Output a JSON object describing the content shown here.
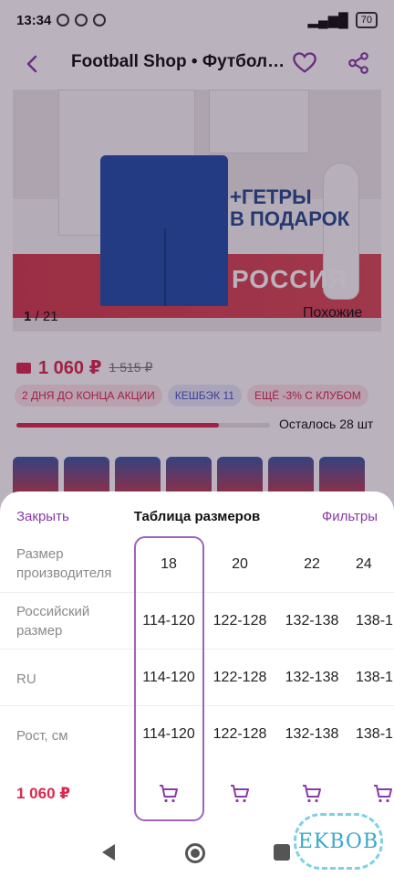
{
  "status_bar": {
    "time": "13:34",
    "battery": "70"
  },
  "topbar": {
    "title": "Football Shop • Футбольная форма"
  },
  "hero": {
    "promo_line1": "+ГЕТРЫ",
    "promo_line2": "В ПОДАРОК",
    "promo_country": "РОССИЯ",
    "counter_current": "1",
    "counter_total": "/ 21",
    "similar": "Похожие"
  },
  "price": {
    "current": "1 060 ₽",
    "old": "1 515 ₽"
  },
  "badges": [
    "2 ДНЯ ДО КОНЦА АКЦИИ",
    "КЕШБЭК 11",
    "ЕЩЁ -3% С КЛУБОМ"
  ],
  "stock": {
    "text": "Осталось 28 шт",
    "fill_fraction": 0.8
  },
  "sheet": {
    "close": "Закрыть",
    "title": "Таблица размеров",
    "filters": "Фильтры",
    "rows": [
      {
        "label": "Размер производителя",
        "values": [
          "18",
          "20",
          "22",
          "24"
        ]
      },
      {
        "label": "Российский размер",
        "values": [
          "114-120",
          "122-128",
          "132-138",
          "138-1"
        ]
      },
      {
        "label": "RU",
        "values": [
          "114-120",
          "122-128",
          "132-138",
          "138-1"
        ]
      },
      {
        "label": "Рост, см",
        "values": [
          "114-120",
          "122-128",
          "132-138",
          "138-1"
        ]
      }
    ],
    "cart_price": "1 060 ₽",
    "selected_column": 0
  },
  "watermark": "EKBOB",
  "colors": {
    "accent_purple": "#8a3aa8",
    "price_red": "#d9294e",
    "selection_border": "#a062bd"
  }
}
